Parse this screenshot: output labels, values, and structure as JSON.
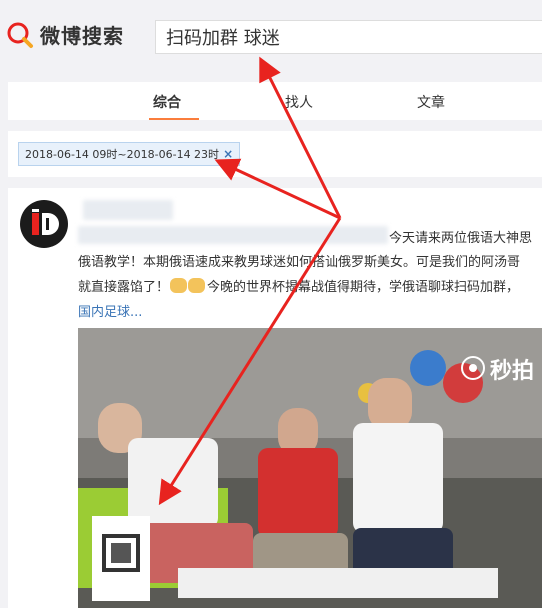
{
  "logo": {
    "text": "微博搜索",
    "icon": "weibo-search-icon"
  },
  "search": {
    "value": "扫码加群 球迷"
  },
  "tabs": [
    {
      "label": "综合"
    },
    {
      "label": "找人"
    },
    {
      "label": "文章"
    }
  ],
  "filter": {
    "label": "2018-06-14 09时~2018-06-14 23时",
    "close": "×"
  },
  "post": {
    "line1": "今天请来两位俄语大神思",
    "line2": "俄语教学！本期俄语速成来教男球迷如何搭讪俄罗斯美女。可是我们的阿汤哥",
    "line3_pre": "就直接露馅了！",
    "line3_post": "今晚的世界杯揭幕战值得期待，学俄语聊球扫码加群，",
    "topic": "国内足球...",
    "watermark": "秒拍"
  },
  "colors": {
    "accent": "#fa7d3c",
    "link": "#3a74b6",
    "arrow": "#e8231f"
  }
}
